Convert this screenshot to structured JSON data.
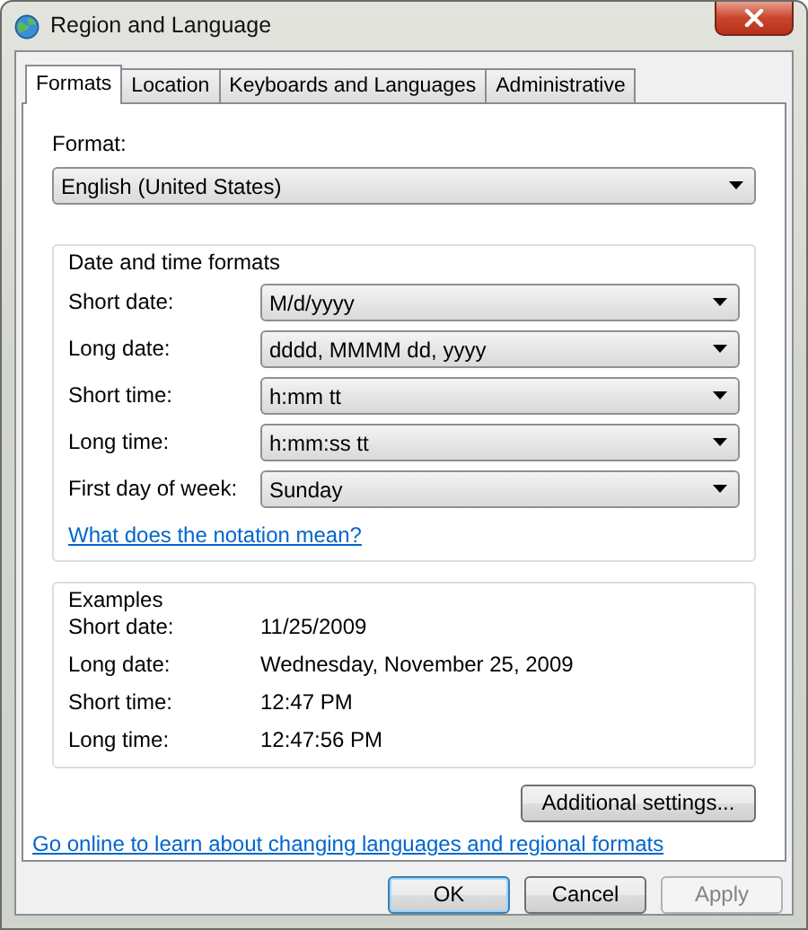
{
  "window": {
    "title": "Region and Language"
  },
  "tabs": [
    {
      "label": "Formats",
      "selected": true
    },
    {
      "label": "Location",
      "selected": false
    },
    {
      "label": "Keyboards and Languages",
      "selected": false
    },
    {
      "label": "Administrative",
      "selected": false
    }
  ],
  "format": {
    "label": "Format:",
    "value": "English (United States)"
  },
  "date_time_formats": {
    "title": "Date and time formats",
    "rows": [
      {
        "label": "Short date:",
        "value": "M/d/yyyy"
      },
      {
        "label": "Long date:",
        "value": "dddd, MMMM dd, yyyy"
      },
      {
        "label": "Short time:",
        "value": "h:mm tt"
      },
      {
        "label": "Long time:",
        "value": "h:mm:ss tt"
      },
      {
        "label": "First day of week:",
        "value": "Sunday"
      }
    ],
    "link": "What does the notation mean?"
  },
  "examples": {
    "title": "Examples",
    "rows": [
      {
        "label": "Short date:",
        "value": "11/25/2009"
      },
      {
        "label": "Long date:",
        "value": "Wednesday, November 25, 2009"
      },
      {
        "label": "Short time:",
        "value": "12:47 PM"
      },
      {
        "label": "Long time:",
        "value": "12:47:56 PM"
      }
    ]
  },
  "additional_settings_button": "Additional settings...",
  "online_link": "Go online to learn about changing languages and regional formats",
  "buttons": [
    {
      "label": "OK",
      "default": true,
      "disabled": false
    },
    {
      "label": "Cancel",
      "default": false,
      "disabled": false
    },
    {
      "label": "Apply",
      "default": false,
      "disabled": true
    }
  ]
}
